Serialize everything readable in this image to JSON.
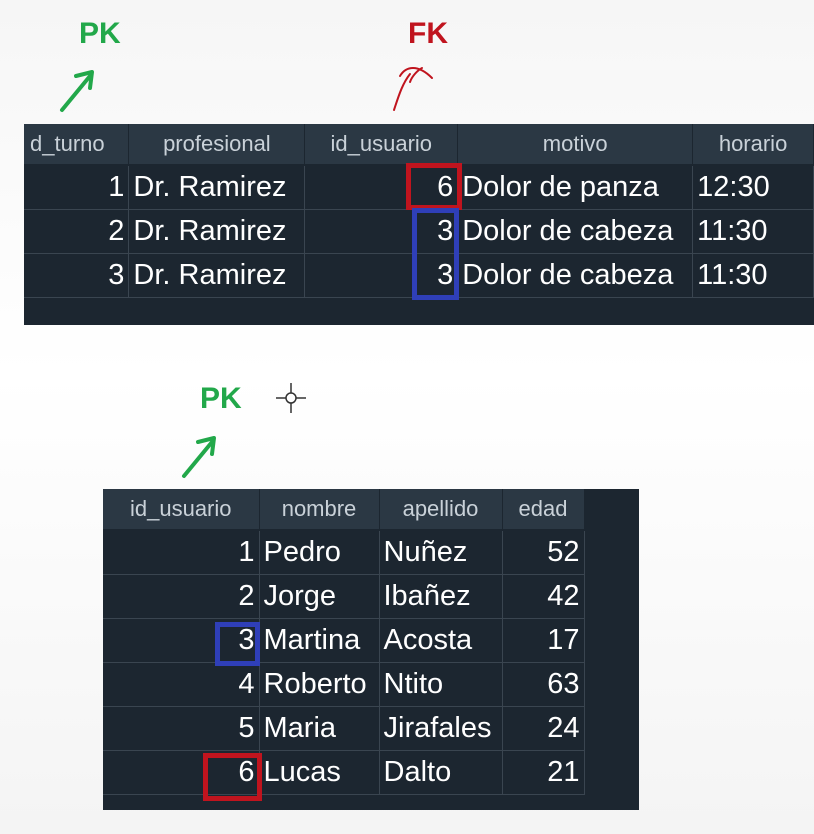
{
  "annotations": {
    "pk_top": "PK",
    "fk_top": "FK",
    "pk_bottom": "PK"
  },
  "colors": {
    "pk": "#22a84a",
    "fk": "#c0141e",
    "highlight_red": "#c0141e",
    "highlight_blue": "#2f3fb8",
    "table_bg": "#1c2630",
    "header_bg": "#2b3844"
  },
  "turnos_table": {
    "columns": [
      "d_turno",
      "profesional",
      "id_usuario",
      "motivo",
      "horario"
    ],
    "rows": [
      [
        "1",
        "Dr. Ramirez",
        "6",
        "Dolor de panza",
        "12:30"
      ],
      [
        "2",
        "Dr. Ramirez",
        "3",
        "Dolor de cabeza",
        "11:30"
      ],
      [
        "3",
        "Dr. Ramirez",
        "3",
        "Dolor de cabeza",
        "11:30"
      ]
    ]
  },
  "usuarios_table": {
    "columns": [
      "id_usuario",
      "nombre",
      "apellido",
      "edad"
    ],
    "rows": [
      [
        "1",
        "Pedro",
        "Nuñez",
        "52"
      ],
      [
        "2",
        "Jorge",
        "Ibañez",
        "42"
      ],
      [
        "3",
        "Martina",
        "Acosta",
        "17"
      ],
      [
        "4",
        "Roberto",
        "Ntito",
        "63"
      ],
      [
        "5",
        "Maria",
        "Jirafales",
        "24"
      ],
      [
        "6",
        "Lucas",
        "Dalto",
        "21"
      ]
    ]
  },
  "icons": [
    "arrow-up-right-icon",
    "curved-arrow-icon",
    "crosshair-cursor-icon"
  ]
}
